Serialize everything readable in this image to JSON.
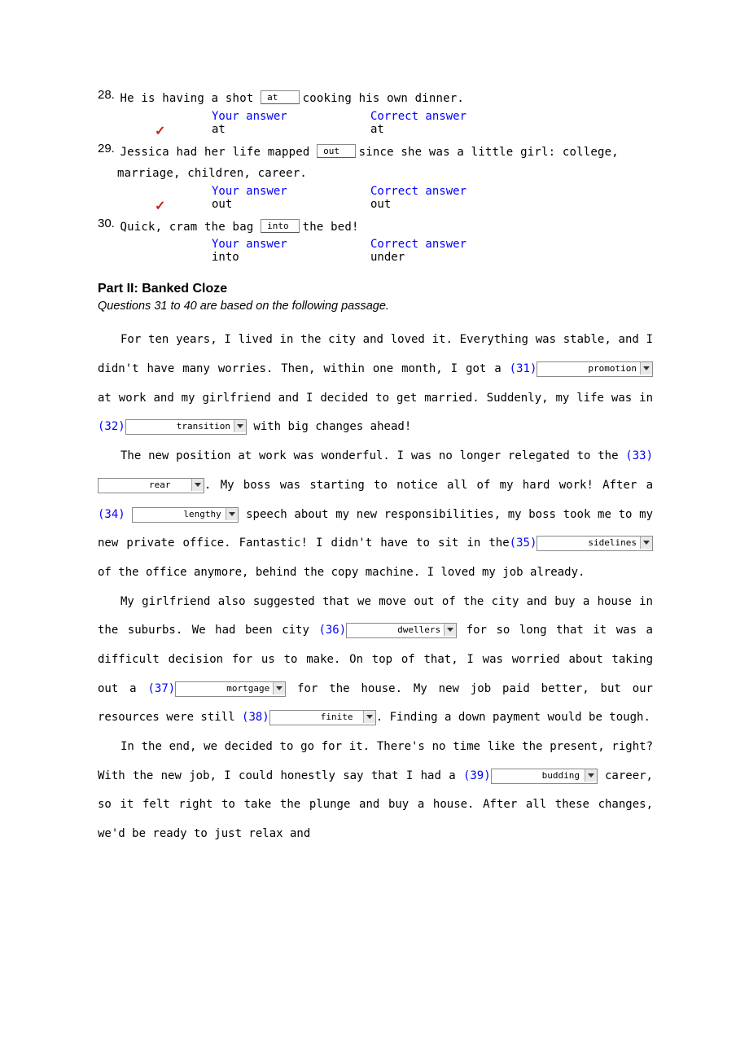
{
  "questions": [
    {
      "num": "28.",
      "pre": "He is having a shot ",
      "input": "at",
      "post": " cooking his own dinner.",
      "your": "at",
      "correct": "at",
      "mark": "✓"
    },
    {
      "num": "29.",
      "pre": "Jessica had her life mapped ",
      "input": "out",
      "post": " since she was a little girl: college,",
      "cont": "marriage, children, career.",
      "your": "out",
      "correct": "out",
      "mark": "✓"
    },
    {
      "num": "30.",
      "pre": "Quick, cram the bag ",
      "input": "into",
      "post": " the bed!",
      "your": "into",
      "correct": "under",
      "mark": ""
    }
  ],
  "headers": {
    "your": "Your answer",
    "correct": "Correct answer"
  },
  "part2": {
    "title": "Part II: Banked Cloze",
    "sub": "Questions 31 to 40 are based on the following passage."
  },
  "blanks": {
    "b31": {
      "n": "(31)",
      "v": "promotion"
    },
    "b32": {
      "n": "(32)",
      "v": "transition"
    },
    "b33": {
      "n": "(33)",
      "v": "rear"
    },
    "b34": {
      "n": "(34)",
      "v": "lengthy"
    },
    "b35": {
      "n": "(35)",
      "v": "sidelines"
    },
    "b36": {
      "n": "(36)",
      "v": "dwellers"
    },
    "b37": {
      "n": "(37)",
      "v": "mortgage"
    },
    "b38": {
      "n": "(38)",
      "v": "finite"
    },
    "b39": {
      "n": "(39)",
      "v": "budding"
    }
  },
  "passage": {
    "p1a": "For ten years, I lived in the city and loved it. Everything was stable, and I didn't have many worries. Then, within one month, I got a ",
    "p1b": " at work and my girlfriend and I decided to get married. Suddenly, my life was in ",
    "p1c": " with big changes ahead!",
    "p2a": "The new position at work was wonderful. I was no longer relegated to the ",
    "p2b": ". My boss was starting to notice all of my hard work! After a ",
    "p2c": " speech about my new responsibilities, my boss took me to my new private office. Fantastic! I didn't have to sit in the",
    "p2d": " of the office anymore, behind the copy machine. I loved my job already.",
    "p3a": "My girlfriend also suggested that we move out of the city and buy a house in the suburbs. We had been city ",
    "p3b": " for so long that it was a difficult decision for us to make. On top of that, I was worried about taking out a ",
    "p3c": " for the house. My new job paid better, but our resources were still ",
    "p3d": ". Finding a down payment would be tough.",
    "p4a": "In the end, we decided to go for it. There's no time like the present, right? With the new job, I could honestly say that I had a ",
    "p4b": " career, so it felt right to take the plunge and buy a house. After all these changes, we'd be ready to just relax and"
  }
}
